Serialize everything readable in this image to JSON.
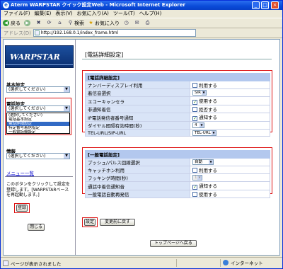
{
  "window": {
    "title": "Aterm WARPSTAR クイック設定Web - Microsoft Internet Explorer"
  },
  "menubar": [
    "ファイル(F)",
    "編集(E)",
    "表示(V)",
    "お気に入り(A)",
    "ツール(T)",
    "ヘルプ(H)"
  ],
  "toolbar": {
    "back": "戻る",
    "search": "検索",
    "favorites": "お気に入り"
  },
  "address": {
    "label": "アドレス(D)",
    "url": "http://192.168.0.1/index_frame.html"
  },
  "left": {
    "logo": "WARPSTAR",
    "basic_label": "基本設定",
    "basic_value": "(選択してください)",
    "phone_label": "電話設定",
    "phone_value": "(選択してください)",
    "phone_options": [
      "(選択してください)",
      "電話基本設定",
      "電話詳細設定",
      "特定番号着信指定",
      "一般電話機設定"
    ],
    "info_label": "情報",
    "info_value": "(選択してください)",
    "menu_link": "メニュー一覧",
    "hint": "このボタンをクリックして設定を登録します。[WARPSTARベースを再起動します。]",
    "register_button": "登録",
    "close_button": "閉じる"
  },
  "right": {
    "page_title": "[電話詳細設定]",
    "detail": {
      "header": "[電話詳細設定]",
      "rows": [
        {
          "label": "ナンバーディスプレイ利用",
          "type": "check",
          "checked": false,
          "text": "利用する"
        },
        {
          "label": "着信音選択",
          "type": "select",
          "value": "SIR"
        },
        {
          "label": "エコーキャンセラ",
          "type": "check",
          "checked": true,
          "text": "使用する"
        },
        {
          "label": "非通知着信",
          "type": "check",
          "checked": false,
          "text": "拒否する"
        },
        {
          "label": "IP電話発信者番号通知",
          "type": "check",
          "checked": true,
          "text": "通知する"
        },
        {
          "label": "ダイヤル間隔有効時間(秒)",
          "type": "select",
          "value": "4"
        },
        {
          "label": "TEL-URL/SIP-URL",
          "type": "select",
          "value": "TEL-URL"
        }
      ]
    },
    "general": {
      "header": "[一般電話設定]",
      "rows": [
        {
          "label": "プッシュ/パルス回線選択",
          "type": "select",
          "value": "自動"
        },
        {
          "label": "キャッチホン利用",
          "type": "check",
          "checked": false,
          "text": "利用する"
        },
        {
          "label": "フッキング時間(秒)",
          "type": "select",
          "value": "1",
          "disabled": true
        },
        {
          "label": "通話中着信通知音",
          "type": "check",
          "checked": true,
          "text": "通知する"
        },
        {
          "label": "一般電話自動再発信",
          "type": "check",
          "checked": false,
          "text": "使用する"
        }
      ]
    },
    "set_button": "設定",
    "revert_button": "変更前に戻す",
    "top_button": "トップページへ戻る"
  },
  "status": {
    "text": "ページが表示されました",
    "zone": "インターネット"
  }
}
